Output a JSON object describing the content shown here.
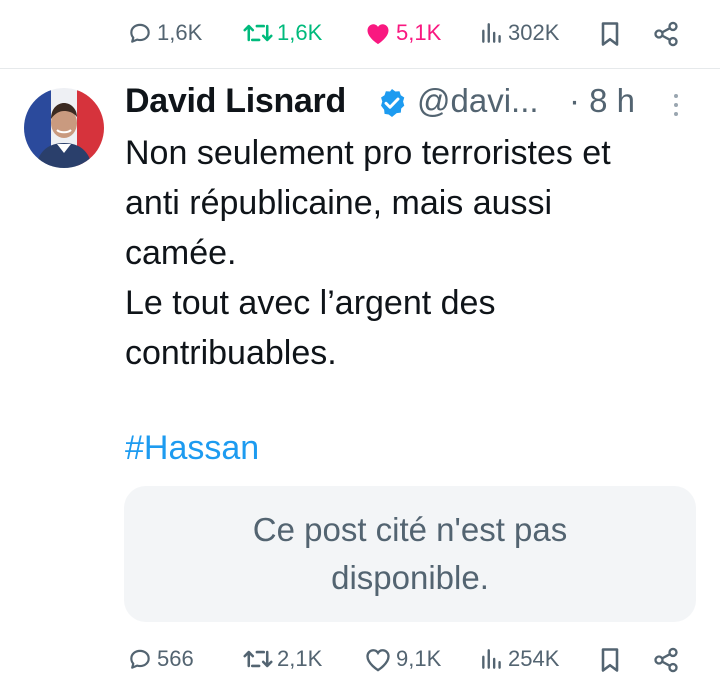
{
  "top_actions": {
    "replies": "1,6K",
    "reposts": "1,6K",
    "likes": "5,1K",
    "views": "302K"
  },
  "tweet": {
    "author_name": "David Lisnard",
    "handle": "@davi...",
    "time": "· 8 h",
    "text": "Non seulement pro terroristes et\nanti républicaine, mais aussi\ncamée.\nLe tout avec l’argent des\ncontribuables.",
    "hashtag": "#Hassan",
    "quote_unavailable": "Ce post cité n'est pas disponible."
  },
  "bottom_actions": {
    "replies": "566",
    "reposts": "2,1K",
    "likes": "9,1K",
    "views": "254K"
  },
  "colors": {
    "text": "#0f1419",
    "secondary": "#536471",
    "link": "#1d9bf0",
    "repost_active": "#00ba7c",
    "like_active": "#f91880",
    "verified": "#1d9bf0"
  },
  "icons": [
    "reply-icon",
    "repost-icon",
    "like-icon",
    "views-icon",
    "bookmark-icon",
    "share-icon",
    "verified-badge-icon",
    "more-icon"
  ]
}
